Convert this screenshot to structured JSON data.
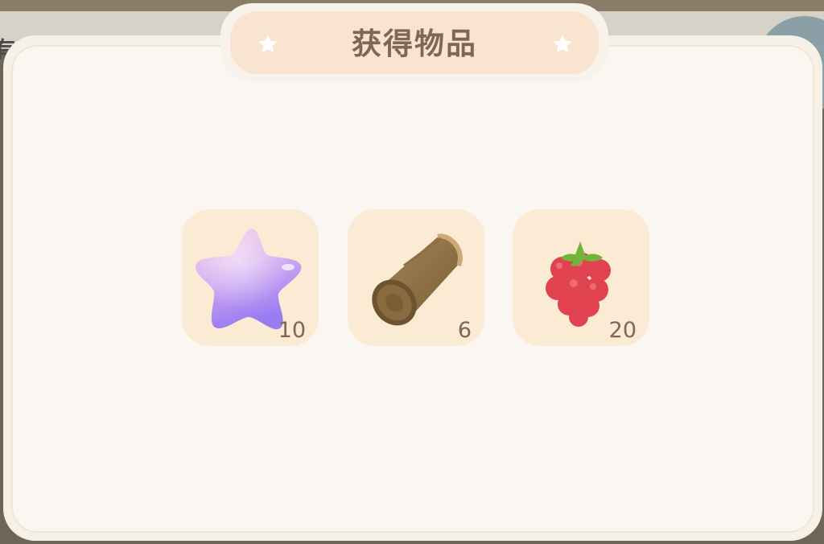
{
  "background": {
    "banner_text": "有直播活动"
  },
  "dialog": {
    "title": "获得物品",
    "title_icons": [
      "star-icon",
      "star-icon"
    ]
  },
  "items": [
    {
      "icon": "purple-star-icon",
      "quantity": "10"
    },
    {
      "icon": "wood-log-icon",
      "quantity": "6"
    },
    {
      "icon": "raspberry-icon",
      "quantity": "20"
    }
  ],
  "colors": {
    "panel": "#faf7f3",
    "tile": "#fbead4",
    "title_tab": "#f8e4cf",
    "text": "#7d6856"
  }
}
